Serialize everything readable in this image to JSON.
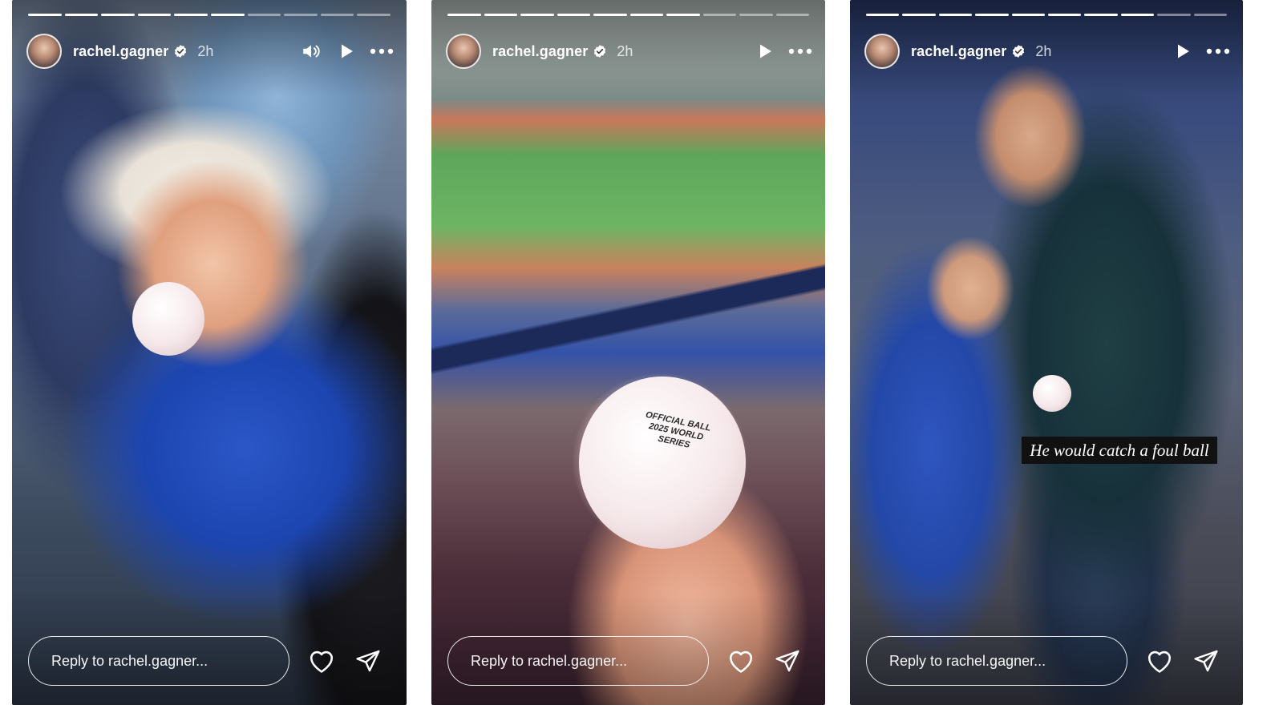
{
  "stories": [
    {
      "username": "rachel.gagner",
      "time": "2h",
      "progress": {
        "segments": 10,
        "current": 6
      },
      "has_sound_icon": true,
      "reply_placeholder": "Reply to rachel.gagner..."
    },
    {
      "username": "rachel.gagner",
      "time": "2h",
      "progress": {
        "segments": 10,
        "current": 7
      },
      "has_sound_icon": false,
      "reply_placeholder": "Reply to rachel.gagner..."
    },
    {
      "username": "rachel.gagner",
      "time": "2h",
      "progress": {
        "segments": 10,
        "current": 8
      },
      "has_sound_icon": false,
      "reply_placeholder": "Reply to rachel.gagner...",
      "caption": "He would catch a foul ball"
    }
  ],
  "ball_text": "OFFICIAL BALL\n2025 WORLD SERIES",
  "icons": {
    "verified": "verified-badge-icon",
    "sound": "speaker-icon",
    "play": "play-icon",
    "more": "more-dots-icon",
    "like": "heart-icon",
    "share": "send-icon"
  },
  "colors": {
    "verified": "#3897f0",
    "icon": "#ffffff"
  }
}
